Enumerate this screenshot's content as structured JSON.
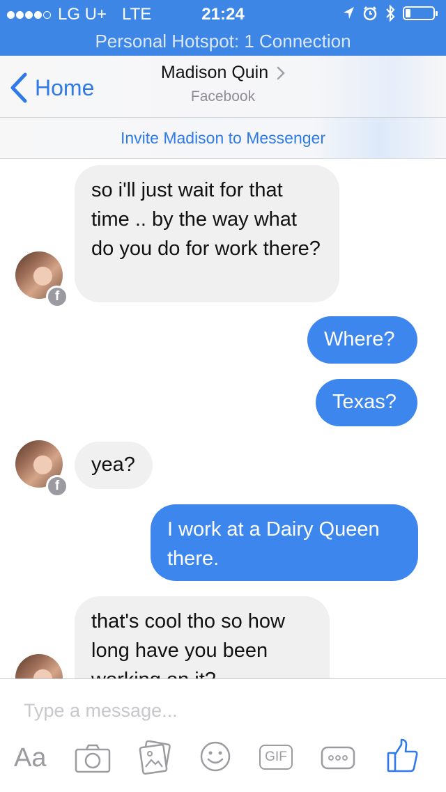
{
  "status_bar": {
    "carrier": "LG U+",
    "network": "LTE",
    "time": "21:24"
  },
  "hotspot_banner": "Personal Hotspot: 1 Connection",
  "nav": {
    "back_label": "Home",
    "contact_name": "Madison Quin",
    "subtitle": "Facebook"
  },
  "invite_banner": "Invite Madison to Messenger",
  "messages": [
    {
      "from": "them",
      "text": "so i'll just wait for that time .. by the way what do you do for work there?"
    },
    {
      "from": "me",
      "text": "Where?"
    },
    {
      "from": "me",
      "text": "Texas?"
    },
    {
      "from": "them",
      "text": "yea?"
    },
    {
      "from": "me",
      "text": "I work at a Dairy Queen there."
    },
    {
      "from": "them",
      "text": "that's cool tho so how long have you been working on it?"
    }
  ],
  "composer": {
    "placeholder": "Type a message...",
    "text_tool_label": "Aa",
    "gif_label": "GIF"
  },
  "colors": {
    "brand_blue": "#3d86e6",
    "outgoing_bubble": "#3d86ee",
    "incoming_bubble": "#f0f0f0",
    "link_blue": "#2f7ae8"
  },
  "icons": [
    "location-arrow-icon",
    "alarm-icon",
    "bluetooth-icon",
    "battery-icon",
    "chevron-left-icon",
    "chevron-right-icon",
    "camera-icon",
    "photo-gallery-icon",
    "emoji-icon",
    "gif-icon",
    "more-icon",
    "thumbs-up-icon",
    "facebook-badge-icon"
  ]
}
